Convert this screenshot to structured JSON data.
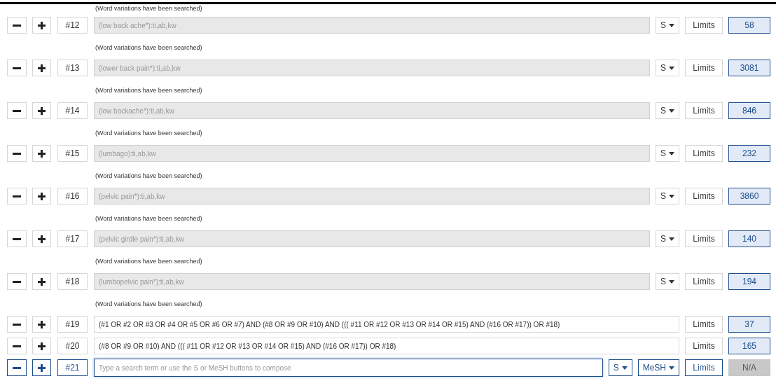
{
  "top_note": "(Word variations have been searched)",
  "rows": [
    {
      "number": "#12",
      "query": "(low back ache*):ti,ab,kw",
      "disabled": true,
      "active": false,
      "note": "(Word variations have been searched)",
      "s_button": "S",
      "limits": "Limits",
      "count": "58"
    },
    {
      "number": "#13",
      "query": "(lower back pain*):ti,ab,kw",
      "disabled": true,
      "active": false,
      "note": "(Word variations have been searched)",
      "s_button": "S",
      "limits": "Limits",
      "count": "3081"
    },
    {
      "number": "#14",
      "query": "(low backache*):ti,ab,kw",
      "disabled": true,
      "active": false,
      "note": "(Word variations have been searched)",
      "s_button": "S",
      "limits": "Limits",
      "count": "846"
    },
    {
      "number": "#15",
      "query": "(lumbago):ti,ab,kw",
      "disabled": true,
      "active": false,
      "note": "(Word variations have been searched)",
      "s_button": "S",
      "limits": "Limits",
      "count": "232"
    },
    {
      "number": "#16",
      "query": "(pelvic pain*):ti,ab,kw",
      "disabled": true,
      "active": false,
      "note": "(Word variations have been searched)",
      "s_button": "S",
      "limits": "Limits",
      "count": "3860"
    },
    {
      "number": "#17",
      "query": "(pelvic girdle pain*):ti,ab,kw",
      "disabled": true,
      "active": false,
      "note": "(Word variations have been searched)",
      "s_button": "S",
      "limits": "Limits",
      "count": "140"
    },
    {
      "number": "#18",
      "query": "(lumbopelvic pain*):ti,ab,kw",
      "disabled": true,
      "active": false,
      "note": "(Word variations have been searched)",
      "s_button": "S",
      "limits": "Limits",
      "count": "194"
    },
    {
      "number": "#19",
      "query": "(#1 OR #2 OR #3 OR #4 OR #5 OR #6 OR #7) AND (#8 OR #9 OR #10) AND ((( #11 OR #12 OR #13 OR #14 OR #15) AND (#16 OR #17)) OR #18)",
      "disabled": false,
      "active": false,
      "limits": "Limits",
      "count": "37"
    },
    {
      "number": "#20",
      "query": "(#8 OR #9 OR #10) AND ((( #11 OR #12 OR #13 OR #14 OR #15) AND (#16 OR #17)) OR #18)",
      "disabled": false,
      "active": false,
      "limits": "Limits",
      "count": "165"
    },
    {
      "number": "#21",
      "placeholder": "Type a search term or use the S or MeSH buttons to compose",
      "active": true,
      "s_button": "S",
      "mesh_button": "MeSH",
      "limits": "Limits",
      "count": "N/A"
    }
  ]
}
